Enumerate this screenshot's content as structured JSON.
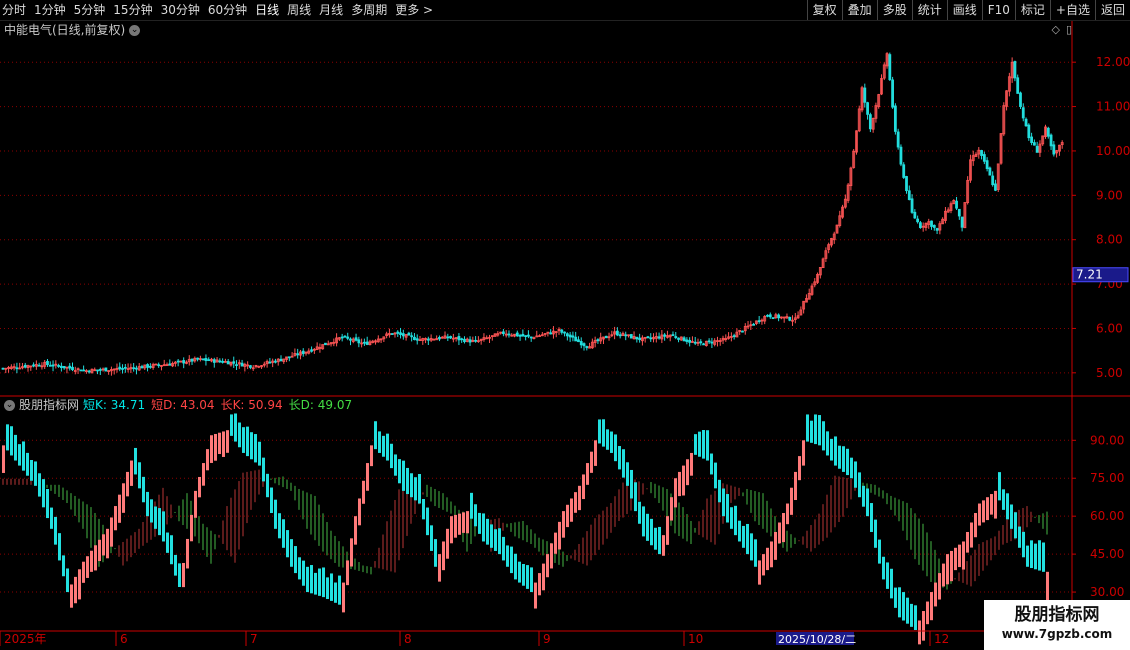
{
  "toolbar": {
    "periods": [
      "分时",
      "1分钟",
      "5分钟",
      "15分钟",
      "30分钟",
      "60分钟",
      "日线",
      "周线",
      "月线",
      "多周期",
      "更多 >"
    ],
    "active_period": "日线",
    "tools": [
      "复权",
      "叠加",
      "多股",
      "统计",
      "画线",
      "F10",
      "标记",
      "+自选",
      "返回"
    ]
  },
  "stock": {
    "title": "中能电气(日线,前复权)"
  },
  "indicator": {
    "name": "股朋指标网",
    "values": [
      {
        "label": "短K: 34.71",
        "color": "#00e6e6"
      },
      {
        "label": "短D: 43.04",
        "color": "#ff4444"
      },
      {
        "label": "长K: 50.94",
        "color": "#ff4444"
      },
      {
        "label": "长D: 49.07",
        "color": "#44dd44"
      }
    ]
  },
  "price_axis": {
    "labels": [
      "12.00",
      "11.00",
      "10.00",
      "9.00",
      "8.00",
      "7.00",
      "6.00",
      "5.00"
    ],
    "current_price": "7.21"
  },
  "indicator_axis": {
    "labels": [
      "90.00",
      "75.00",
      "60.00",
      "45.00",
      "30.00"
    ]
  },
  "time_axis": {
    "labels": [
      "2025年",
      "6",
      "7",
      "8",
      "9",
      "10",
      "12"
    ],
    "cursor_label": "2025/10/28/二"
  },
  "watermark": {
    "line1": "股朋指标网",
    "line2": "www.7gpzb.com"
  },
  "colors": {
    "up": "#ff5555",
    "down": "#22dddd",
    "grid": "#8b0000",
    "axis": "#cc0000"
  },
  "chart_data": {
    "type": "candlestick",
    "price_ylim": [
      4.5,
      12.5
    ],
    "indicator_ylim": [
      15,
      100
    ],
    "price_path": [
      [
        0,
        5.1
      ],
      [
        15,
        5.2
      ],
      [
        30,
        5.05
      ],
      [
        45,
        5.1
      ],
      [
        60,
        5.2
      ],
      [
        70,
        5.3
      ],
      [
        80,
        5.25
      ],
      [
        90,
        5.15
      ],
      [
        100,
        5.3
      ],
      [
        110,
        5.5
      ],
      [
        122,
        5.8
      ],
      [
        130,
        5.65
      ],
      [
        140,
        5.9
      ],
      [
        150,
        5.75
      ],
      [
        160,
        5.8
      ],
      [
        170,
        5.7
      ],
      [
        180,
        5.9
      ],
      [
        190,
        5.8
      ],
      [
        200,
        5.95
      ],
      [
        210,
        5.6
      ],
      [
        220,
        5.9
      ],
      [
        230,
        5.75
      ],
      [
        240,
        5.85
      ],
      [
        250,
        5.65
      ],
      [
        260,
        5.75
      ],
      [
        275,
        6.3
      ],
      [
        285,
        6.2
      ],
      [
        293,
        7.2
      ],
      [
        297,
        7.9
      ],
      [
        300,
        8.3
      ],
      [
        303,
        8.9
      ],
      [
        306,
        10.0
      ],
      [
        309,
        11.4
      ],
      [
        312,
        10.5
      ],
      [
        315,
        11.3
      ],
      [
        318,
        12.2
      ],
      [
        321,
        10.4
      ],
      [
        324,
        9.4
      ],
      [
        327,
        8.6
      ],
      [
        330,
        8.3
      ],
      [
        333,
        8.4
      ],
      [
        336,
        8.2
      ],
      [
        339,
        8.6
      ],
      [
        342,
        8.9
      ],
      [
        345,
        8.3
      ],
      [
        348,
        9.8
      ],
      [
        351,
        10.0
      ],
      [
        354,
        9.6
      ],
      [
        357,
        9.1
      ],
      [
        360,
        11.0
      ],
      [
        363,
        12.0
      ],
      [
        366,
        11.0
      ],
      [
        369,
        10.3
      ],
      [
        372,
        10.0
      ],
      [
        375,
        10.5
      ],
      [
        378,
        9.9
      ],
      [
        381,
        10.2
      ]
    ],
    "kd_path": [
      [
        0,
        88
      ],
      [
        4,
        80
      ],
      [
        8,
        72
      ],
      [
        12,
        55
      ],
      [
        16,
        30
      ],
      [
        20,
        42
      ],
      [
        26,
        55
      ],
      [
        32,
        82
      ],
      [
        36,
        60
      ],
      [
        40,
        50
      ],
      [
        44,
        32
      ],
      [
        48,
        70
      ],
      [
        52,
        92
      ],
      [
        56,
        94
      ],
      [
        60,
        85
      ],
      [
        64,
        80
      ],
      [
        68,
        55
      ],
      [
        72,
        40
      ],
      [
        76,
        30
      ],
      [
        80,
        28
      ],
      [
        84,
        25
      ],
      [
        88,
        60
      ],
      [
        92,
        88
      ],
      [
        96,
        82
      ],
      [
        100,
        70
      ],
      [
        104,
        65
      ],
      [
        108,
        40
      ],
      [
        112,
        60
      ],
      [
        116,
        62
      ],
      [
        120,
        50
      ],
      [
        124,
        45
      ],
      [
        128,
        35
      ],
      [
        132,
        30
      ],
      [
        136,
        45
      ],
      [
        140,
        62
      ],
      [
        144,
        72
      ],
      [
        148,
        90
      ],
      [
        152,
        85
      ],
      [
        156,
        72
      ],
      [
        160,
        52
      ],
      [
        164,
        45
      ],
      [
        168,
        75
      ],
      [
        172,
        85
      ],
      [
        176,
        82
      ],
      [
        180,
        60
      ],
      [
        184,
        50
      ],
      [
        188,
        40
      ],
      [
        192,
        50
      ],
      [
        196,
        65
      ],
      [
        200,
        90
      ],
      [
        204,
        88
      ],
      [
        208,
        80
      ],
      [
        212,
        75
      ],
      [
        216,
        60
      ],
      [
        220,
        35
      ],
      [
        224,
        20
      ],
      [
        228,
        15
      ],
      [
        232,
        30
      ],
      [
        236,
        45
      ],
      [
        240,
        50
      ],
      [
        244,
        65
      ],
      [
        248,
        70
      ],
      [
        252,
        55
      ],
      [
        256,
        40
      ],
      [
        260,
        38
      ]
    ]
  }
}
